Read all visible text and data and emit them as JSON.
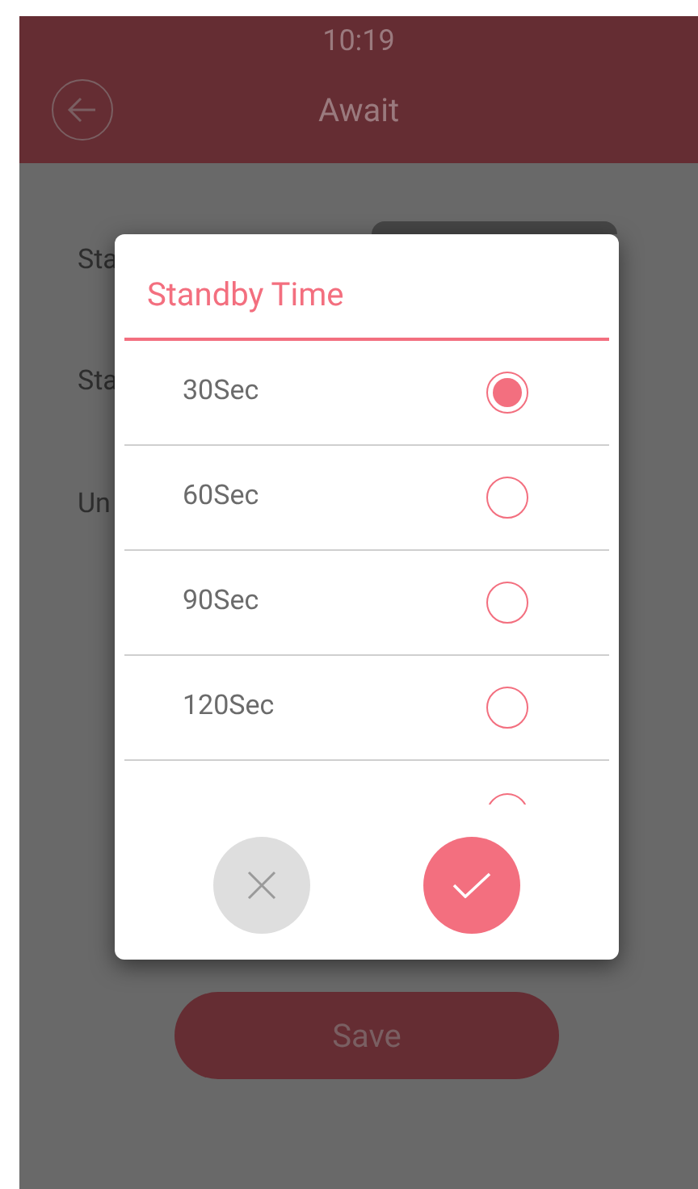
{
  "status_bar": {
    "time": "10:19"
  },
  "header": {
    "title": "Await"
  },
  "settings": [
    {
      "label": "Sta"
    },
    {
      "label": "Sta"
    },
    {
      "label": "Un"
    }
  ],
  "save_button": {
    "label": "Save"
  },
  "dialog": {
    "title": "Standby Time",
    "options": [
      {
        "label": "30Sec",
        "selected": true
      },
      {
        "label": "60Sec",
        "selected": false
      },
      {
        "label": "90Sec",
        "selected": false
      },
      {
        "label": "120Sec",
        "selected": false
      },
      {
        "selected": false
      }
    ]
  }
}
